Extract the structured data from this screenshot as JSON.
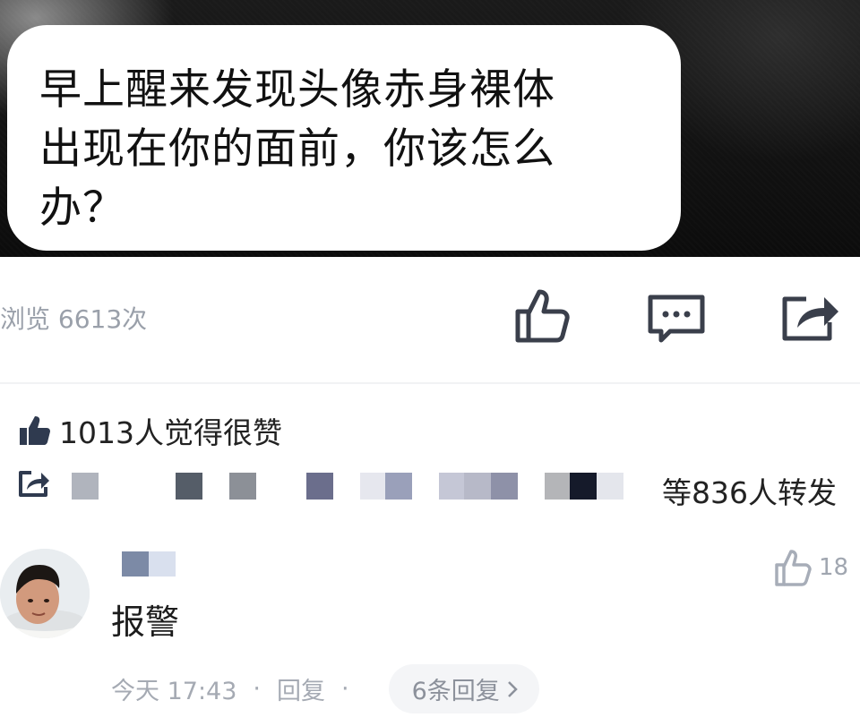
{
  "post": {
    "caption": "早上醒来发现头像赤身裸体\n出现在你的面前，你该怎么\n办？",
    "views": "浏览 6613次"
  },
  "actions": {
    "like_icon": "thumbs-up-icon",
    "comment_icon": "comment-icon",
    "share_icon": "share-icon"
  },
  "likes": {
    "text": "1013人觉得很赞"
  },
  "forwards": {
    "text": "等836人转发",
    "mosaic_colors": [
      "#b0b4bd",
      "#555d68",
      "#8c9097",
      "#6b6e8c",
      "#e6e7ee",
      "#9aa0ba",
      "#c5c7d6",
      "#b7b9c8",
      "#8e91a8",
      "#b4b5b8",
      "#151a2a",
      "#e4e6ec"
    ]
  },
  "comment": {
    "name_mosaic": [
      "#7c8aa6",
      "#d9e0ee"
    ],
    "text": "报警",
    "like_count": "18",
    "time": "今天 17:43",
    "reply_label": "回复",
    "replies_label": "6条回复"
  },
  "colors": {
    "icon_dark": "#3a3f4b",
    "icon_light": "#a7adb8",
    "accent": "#2f3a4f"
  }
}
